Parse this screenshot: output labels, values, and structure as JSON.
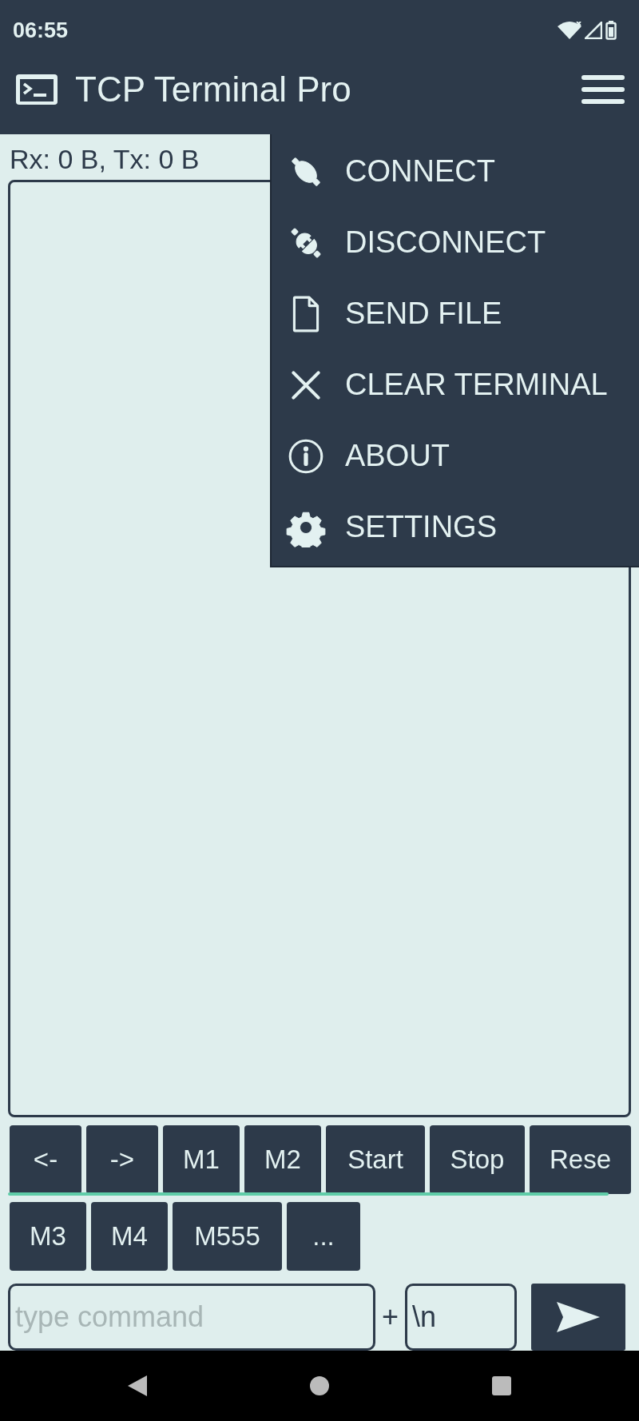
{
  "status_bar": {
    "time": "06:55"
  },
  "app_bar": {
    "title": "TCP Terminal Pro"
  },
  "stats": "Rx: 0 B, Tx: 0 B",
  "menu": {
    "items": [
      {
        "label": "CONNECT",
        "kind": "connect"
      },
      {
        "label": "DISCONNECT",
        "kind": "disconnect"
      },
      {
        "label": "SEND FILE",
        "kind": "file"
      },
      {
        "label": "CLEAR TERMINAL",
        "kind": "clear"
      },
      {
        "label": "ABOUT",
        "kind": "about"
      },
      {
        "label": "SETTINGS",
        "kind": "settings"
      }
    ]
  },
  "macro_rows": [
    [
      "<-",
      "->",
      "M1",
      "M2",
      "Start",
      "Stop",
      "Rese"
    ],
    [
      "M3",
      "M4",
      "M555",
      "..."
    ]
  ],
  "command": {
    "placeholder": "type command",
    "separator": "+",
    "line_ending": "\\n"
  }
}
